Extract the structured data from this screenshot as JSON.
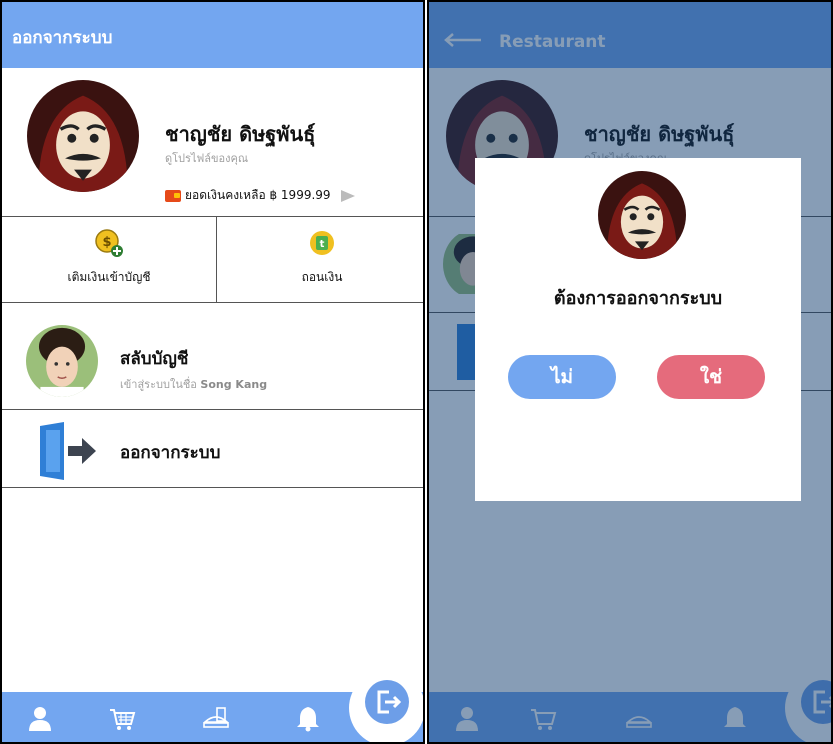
{
  "left": {
    "header_title": "ออกจากระบบ",
    "profile": {
      "name": "ชาญชัย ดิษฐพันธุ์",
      "subtitle": "ดูโปรไฟล์ของคุณ",
      "balance_text": "ยอดเงินคงเหลือ ฿ 1999.99"
    },
    "actions": [
      {
        "label": "เติมเงินเข้าบัญชี"
      },
      {
        "label": "ถอนเงิน"
      }
    ],
    "menu": [
      {
        "title": "สลับบัญชี",
        "subtitle_prefix": "เข้าสู่ระบบในชื่อ",
        "subtitle_name": "Song Kang"
      },
      {
        "title": "ออกจากระบบ"
      }
    ]
  },
  "right": {
    "header_title": "Restaurant",
    "profile_name": "ชาญชัย ดิษฐพันธุ์",
    "profile_subtitle": "ดูโปรไฟล์ของคุณ",
    "dialog": {
      "question": "ต้องการออกจากระบบ",
      "no_label": "ไม่",
      "yes_label": "ใช่"
    }
  },
  "icons": [
    "profile-icon",
    "cart-icon",
    "food-icon",
    "bell-icon",
    "logout-icon",
    "coin-add-icon",
    "withdraw-icon",
    "wallet-icon",
    "door-exit-icon",
    "back-arrow-icon"
  ],
  "colors": {
    "primary": "#73a6f0",
    "danger": "#e56b7c",
    "coin": "#f0c020"
  }
}
